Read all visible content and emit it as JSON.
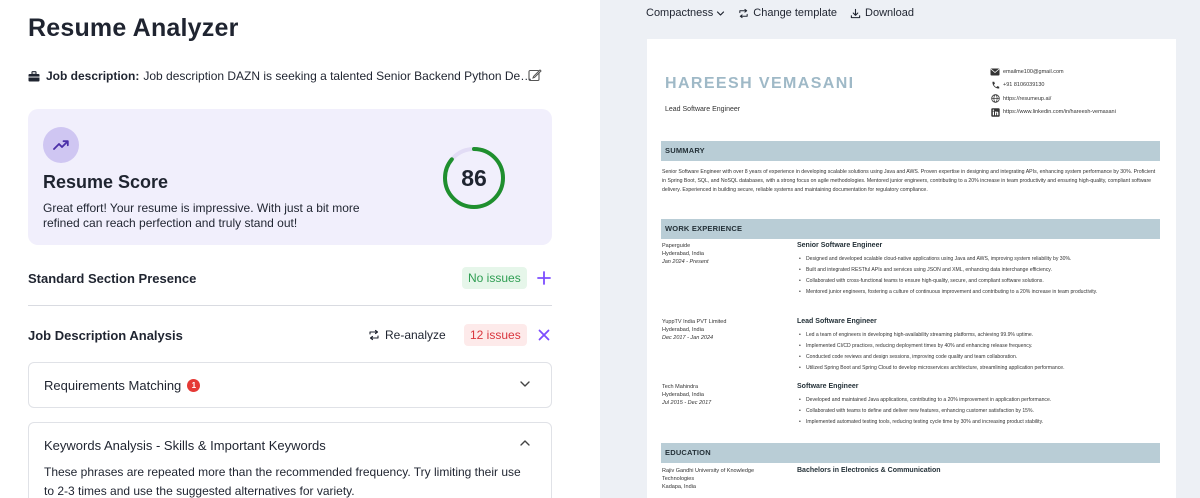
{
  "app": {
    "title": "Resume Analyzer"
  },
  "job_description": {
    "label": "Job description:",
    "text": "Job description DAZN is seeking a talented Senior Backend Python Developer to join our team"
  },
  "score_card": {
    "title": "Resume Score",
    "value": "86",
    "fraction": 0.86,
    "description": "Great effort! Your resume is impressive. With just a bit more refined can reach perfection and truly stand out!"
  },
  "sections": {
    "standard": {
      "title": "Standard Section Presence",
      "badge": "No issues"
    },
    "jd_analysis": {
      "title": "Job Description Analysis",
      "reanalyze": "Re-analyze",
      "badge": "12 issues"
    },
    "requirements": {
      "title": "Requirements Matching",
      "count": "1"
    },
    "keywords": {
      "title": "Keywords Analysis - Skills & Important Keywords",
      "body": "These phrases are repeated more than the recommended frequency. Try limiting their use to 2-3 times and use the suggested alternatives for variety."
    }
  },
  "toolbar": {
    "compactness": "Compactness",
    "change_template": "Change template",
    "download": "Download"
  },
  "resume": {
    "name": "HAREESH VEMASANI",
    "role": "Lead Software Engineer",
    "contacts": {
      "email": "emailme100@gmail.com",
      "phone": "+91 8106039130",
      "website": "https://resumeup.ai/",
      "linkedin": "https://www.linkedin.com/in/hareesh-vemasani"
    },
    "headings": {
      "summary": "SUMMARY",
      "experience": "WORK EXPERIENCE",
      "education": "EDUCATION"
    },
    "summary": "Senior Software Engineer with over 8 years of experience in developing scalable solutions using Java and AWS. Proven expertise in designing and integrating APIs, enhancing system performance by 30%. Proficient in Spring Boot, SQL, and NoSQL databases, with a strong focus on agile methodologies. Mentored junior engineers, contributing to a 20% increase in team productivity and ensuring high-quality, compliant software delivery. Experienced in building secure, reliable systems and maintaining documentation for regulatory compliance.",
    "jobs": [
      {
        "company": "Paperguide",
        "location": "Hyderabad, India",
        "dates": "Jan 2024 - Present",
        "title": "Senior Software Engineer",
        "bullets": [
          "Designed and developed scalable cloud-native applications using Java and AWS, improving system reliability by 30%.",
          "Built and integrated RESTful APIs and services using JSON and XML, enhancing data interchange efficiency.",
          "Collaborated with cross-functional teams to ensure high-quality, secure, and compliant software solutions.",
          "Mentored junior engineers, fostering a culture of continuous improvement and contributing to a 20% increase in team productivity."
        ]
      },
      {
        "company": "YuppTV India PVT Limited",
        "location": "Hyderabad, India",
        "dates": "Dec 2017 - Jan 2024",
        "title": "Lead Software Engineer",
        "bullets": [
          "Led a team of engineers in developing high-availability streaming platforms, achieving 99.9% uptime.",
          "Implemented CI/CD practices, reducing deployment times by 40% and enhancing release frequency.",
          "Conducted code reviews and design sessions, improving code quality and team collaboration.",
          "Utilized Spring Boot and Spring Cloud to develop microservices architecture, streamlining application performance."
        ]
      },
      {
        "company": "Tech Mahindra",
        "location": "Hyderabad, India",
        "dates": "Jul 2015 - Dec 2017",
        "title": "Software Engineer",
        "bullets": [
          "Developed and maintained Java applications, contributing to a 20% improvement in application performance.",
          "Collaborated with teams to define and deliver new features, enhancing customer satisfaction by 15%.",
          "Implemented automated testing tools, reducing testing cycle time by 30% and increasing product stability."
        ]
      }
    ],
    "education": {
      "institution": "Rajiv Gandhi University of Knowledge Technologies",
      "location": "Kadapa, India",
      "degree": "Bachelors in Electronics & Communication"
    }
  },
  "colors": {
    "accent": "#7c4dff",
    "score_ring": "#1f8f2e",
    "card_bg": "#f1effc",
    "ok_badge": "#2f9e53",
    "issue_badge": "#d9363e",
    "section_band": "#b9cdd6"
  },
  "icons": {
    "jd": "briefcase-icon",
    "edit": "edit-icon",
    "score": "trending-up-icon",
    "expand": "plus-icon",
    "collapse": "close-icon",
    "reanalyze": "refresh-icon",
    "accordion_closed": "chevron-down-icon",
    "accordion_open": "chevron-up-icon",
    "change_template": "swap-icon",
    "download": "download-icon"
  }
}
